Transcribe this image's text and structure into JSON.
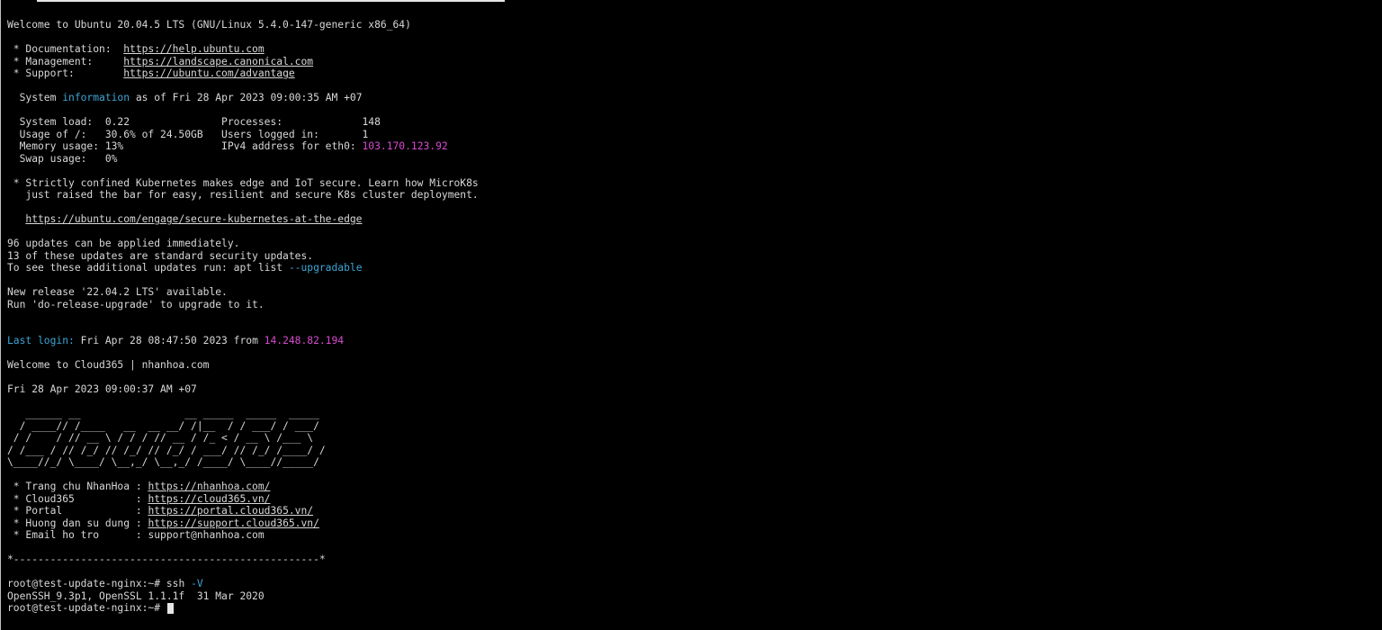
{
  "welcome_line": "Welcome to Ubuntu 20.04.5 LTS (GNU/Linux 5.4.0-147-generic x86_64)",
  "links": {
    "doc_label": " * Documentation:  ",
    "doc_url": "https://help.ubuntu.com",
    "mgmt_label": " * Management:     ",
    "mgmt_url": "https://landscape.canonical.com",
    "support_label": " * Support:        ",
    "support_url": "https://ubuntu.com/advantage"
  },
  "sysinfo": {
    "prefix": "  System ",
    "word": "information",
    "suffix": " as of Fri 28 Apr 2023 09:00:35 AM +07",
    "row1": "  System load:  0.22               Processes:             148",
    "row2": "  Usage of /:   30.6% of 24.50GB   Users logged in:       1",
    "row3_prefix": "  Memory usage: 13%                IPv4 address for eth0: ",
    "row3_ip": "103.170.123.92",
    "row4": "  Swap usage:   0%"
  },
  "kube": {
    "line1": " * Strictly confined Kubernetes makes edge and IoT secure. Learn how MicroK8s",
    "line2": "   just raised the bar for easy, resilient and secure K8s cluster deployment.",
    "indent": "   ",
    "url": "https://ubuntu.com/engage/secure-kubernetes-at-the-edge"
  },
  "updates": {
    "line1": "96 updates can be applied immediately.",
    "line2": "13 of these updates are standard security updates.",
    "line3_prefix": "To see these additional updates run: apt list ",
    "line3_flag": "--upgradable"
  },
  "release": {
    "line1": "New release '22.04.2 LTS' available.",
    "line2": "Run 'do-release-upgrade' to upgrade to it."
  },
  "lastlogin": {
    "label": "Last login:",
    "text": " Fri Apr 28 08:47:50 2023 from ",
    "ip": "14.248.82.194"
  },
  "cloud_welcome": "Welcome to Cloud365 | nhanhoa.com",
  "cloud_date": "Fri 28 Apr 2023 09:00:37 AM +07",
  "banner": [
    "   ______ __                 __ _____  _____  _____",
    "  / ____// /____   __  __ __/ /|__  / / ___/ / ___/",
    " / /    / // __ \\ / / / // __ / /_ < / __ \\ /___ \\",
    "/ /___ / // /_/ // /_/ // /_/ / ___/ // /_/ /____/ /",
    "\\____//_/ \\____/ \\__,_/ \\__,_/ /____/ \\____//_____/"
  ],
  "info": {
    "home_label": " * Trang chu NhanHoa : ",
    "home_url": "https://nhanhoa.com/",
    "cloud_label": " * Cloud365          : ",
    "cloud_url": "https://cloud365.vn/",
    "portal_label": " * Portal            : ",
    "portal_url": "https://portal.cloud365.vn/",
    "guide_label": " * Huong dan su dung : ",
    "guide_url": "https://support.cloud365.vn/",
    "email_label": " * Email ho tro      : ",
    "email": "support@nhanhoa.com"
  },
  "divider": "*--------------------------------------------------*",
  "session": {
    "prompt": "root@test-update-nginx:~# ",
    "cmd": "ssh ",
    "flag": "-V",
    "output": "OpenSSH_9.3p1, OpenSSL 1.1.1f  31 Mar 2020",
    "prompt2": "root@test-update-nginx:~# "
  },
  "colors": {
    "background": "#000000",
    "foreground": "#d8d8d8",
    "cyan": "#3ea6d6",
    "magenta": "#d84ad0"
  }
}
